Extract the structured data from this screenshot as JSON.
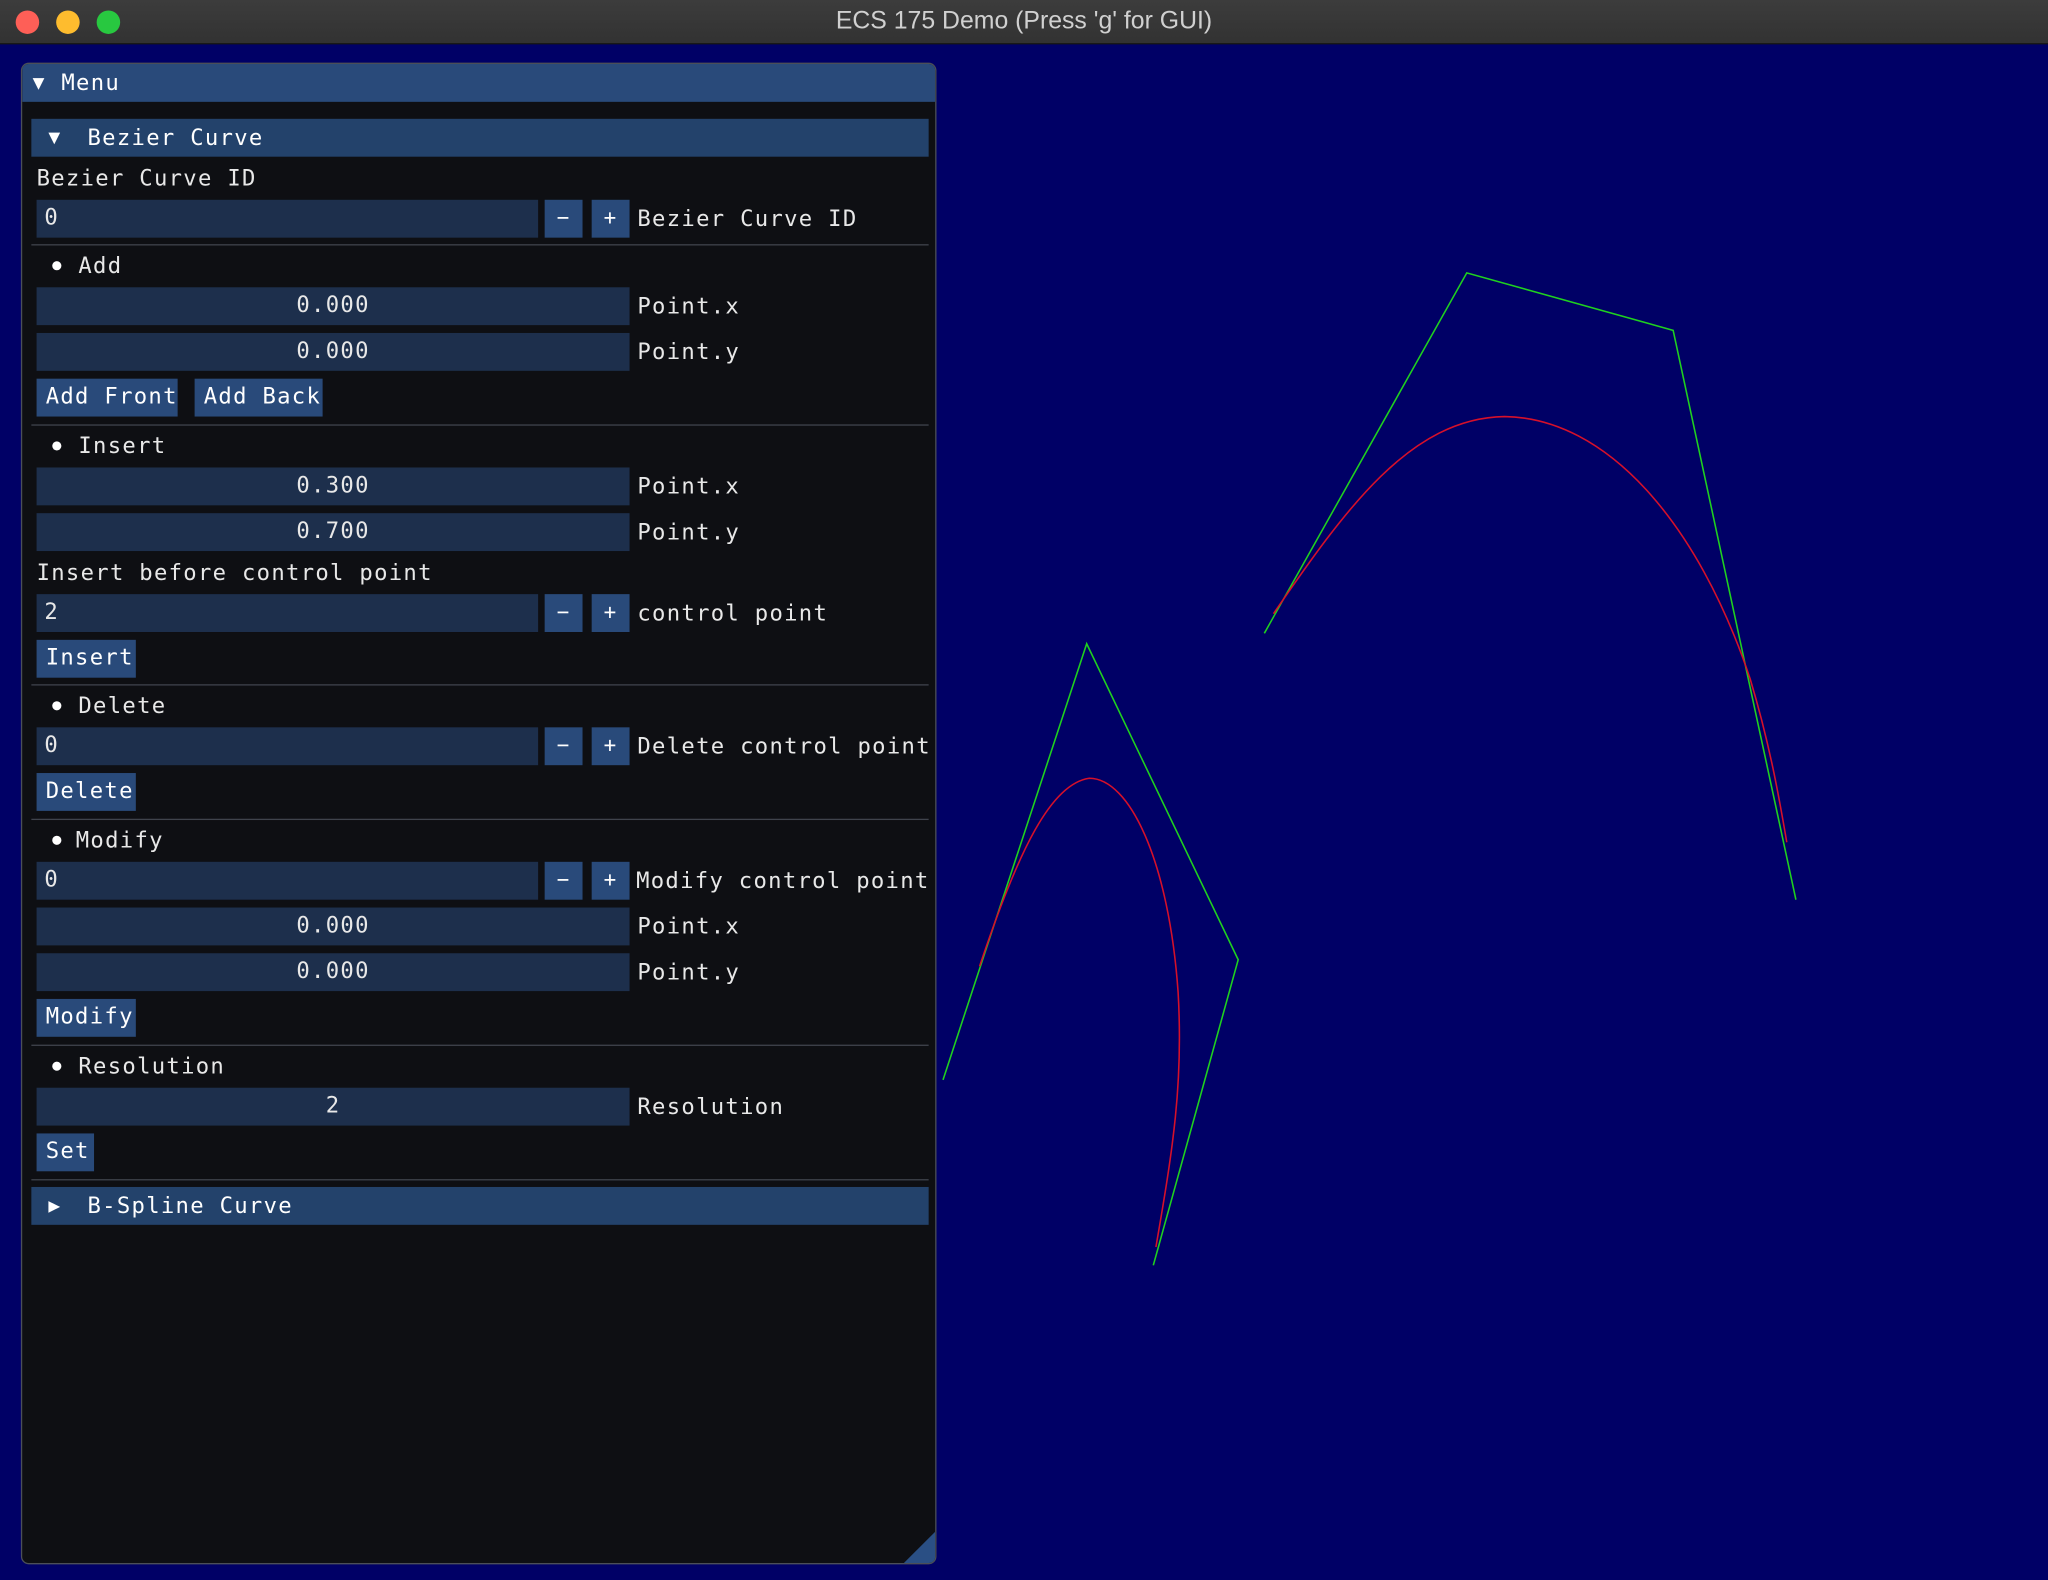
{
  "window": {
    "title": "ECS 175 Demo (Press 'g' for GUI)",
    "background_color": "#000066"
  },
  "menu": {
    "title": "Menu",
    "bezier": {
      "header": "Bezier Curve",
      "id_label": "Bezier Curve ID",
      "id_value": "0",
      "id_field_label": "Bezier Curve ID",
      "add": {
        "heading": "Add",
        "x_value": "0.000",
        "x_label": "Point.x",
        "y_value": "0.000",
        "y_label": "Point.y",
        "front_label": "Add Front",
        "back_label": "Add Back"
      },
      "insert": {
        "heading": "Insert",
        "x_value": "0.300",
        "x_label": "Point.x",
        "y_value": "0.700",
        "y_label": "Point.y",
        "before_label": "Insert before control point",
        "cp_value": "2",
        "cp_label": "control point",
        "button": "Insert"
      },
      "delete": {
        "heading": "Delete",
        "cp_value": "0",
        "cp_label": "Delete control point",
        "button": "Delete"
      },
      "modify": {
        "heading": "Modify",
        "cp_value": "0",
        "cp_label": "Modify control point",
        "x_value": "0.000",
        "x_label": "Point.x",
        "y_value": "0.000",
        "y_label": "Point.y",
        "button": "Modify"
      },
      "resolution": {
        "heading": "Resolution",
        "value": "2",
        "label": "Resolution",
        "button": "Set"
      }
    },
    "bspline": {
      "header": "B-Spline Curve"
    },
    "stepper": {
      "minus": "−",
      "plus": "+"
    }
  },
  "colors": {
    "control_polygon": "#1fd11f",
    "curve": "#d6102a",
    "panel_bg": "#0e0f13",
    "accent": "#294a7a"
  },
  "icons": {
    "expanded": "triangle-down-icon",
    "collapsed": "triangle-right-icon",
    "bullet": "bullet-icon"
  }
}
